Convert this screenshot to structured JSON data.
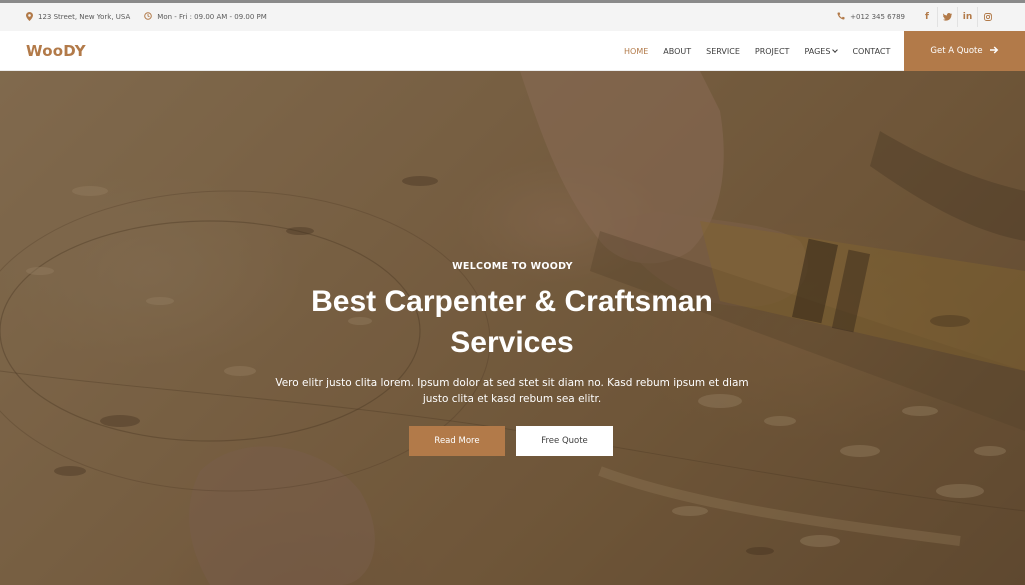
{
  "topbar": {
    "address": "123 Street, New York, USA",
    "hours": "Mon - Fri : 09.00 AM - 09.00 PM",
    "phone": "+012 345 6789",
    "social": [
      {
        "icon": "facebook-icon",
        "glyph": "f"
      },
      {
        "icon": "twitter-icon",
        "glyph": "𝕥"
      },
      {
        "icon": "linkedin-icon",
        "glyph": "in"
      },
      {
        "icon": "instagram-icon",
        "glyph": "◎"
      }
    ]
  },
  "navbar": {
    "brand": "WooDY",
    "items": [
      {
        "label": "HOME",
        "active": true
      },
      {
        "label": "ABOUT"
      },
      {
        "label": "SERVICE"
      },
      {
        "label": "PROJECT"
      },
      {
        "label": "PAGES"
      },
      {
        "label": "CONTACT"
      }
    ],
    "cta_label": "Get A Quote"
  },
  "hero": {
    "kicker": "WELCOME TO WOODY",
    "headline": "Best Carpenter & Craftsman Services",
    "lead": "Vero elitr justo clita lorem. Ipsum dolor at sed stet sit diam no. Kasd rebum ipsum et diam justo clita et kasd rebum sea elitr.",
    "primary_button": "Read More",
    "secondary_button": "Free Quote"
  },
  "colors": {
    "accent": "#b27a49",
    "topbar_bg": "#f4f4f4",
    "text_dark": "#3d3d3d"
  }
}
